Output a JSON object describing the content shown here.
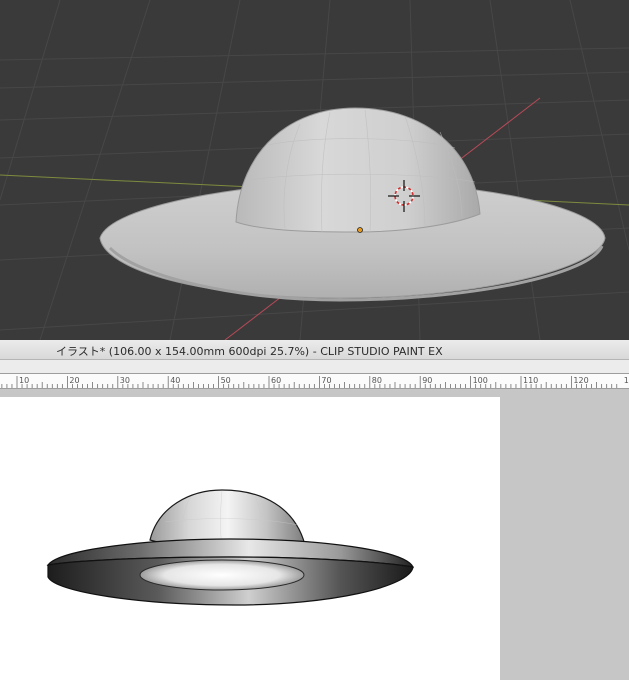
{
  "window": {
    "title": "イラスト* (106.00 x 154.00mm 600dpi 25.7%)  - CLIP STUDIO PAINT EX"
  },
  "ruler": {
    "labels": [
      "10",
      "20",
      "30",
      "40",
      "50",
      "60",
      "70",
      "80",
      "90",
      "100",
      "110",
      "120",
      "13"
    ]
  },
  "viewport": {
    "background_color": "#3a3a3a",
    "grid_color": "#4a4a4a",
    "x_axis_color": "#c0505c",
    "y_axis_color": "#8a9a4a",
    "origin_dot_color": "#e89a20"
  },
  "icons": {
    "camera_target": "crosshair-3d-cursor-icon"
  }
}
